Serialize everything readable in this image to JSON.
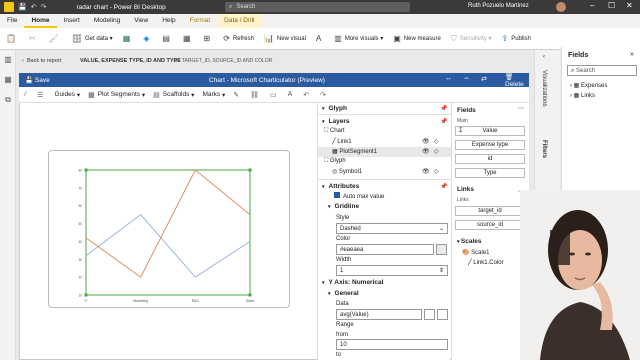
{
  "window": {
    "title": "radar chart - Power BI Desktop",
    "search_placeholder": "Search",
    "user": "Ruth Pozuelo Martinez"
  },
  "ribbon_tabs": [
    "File",
    "Home",
    "Insert",
    "Modeling",
    "View",
    "Help",
    "Format",
    "Data / Drill"
  ],
  "ribbon": {
    "get_data": "Get data",
    "refresh": "Refresh",
    "new_visual": "New visual",
    "more_visuals": "More visuals",
    "new_measure": "New measure",
    "sensitivity": "Sensitivity",
    "publish": "Publish"
  },
  "editor": {
    "back_label": "Back to report",
    "fields_caption": "VALUE, EXPENSE TYPE, ID AND TYPE",
    "by_caption": "BY TARGET_ID, SOURCE_ID AND COLOR",
    "save": "Save",
    "title": "Chart - Microsoft Charticulator (Preview)",
    "delete": "Delete",
    "toolbar": [
      "Guides",
      "Plot Segments",
      "Scaffolds",
      "Marks"
    ]
  },
  "glyph_panel": {
    "glyph": "Glyph",
    "layers": "Layers",
    "layer_items": [
      "Chart",
      "Link1",
      "PlotSegment1",
      "Glyph",
      "Symbol1"
    ],
    "attributes": "Attributes",
    "auto_max": "Auto max value",
    "gridline": "Gridline",
    "style_label": "Style",
    "style_value": "Dashed",
    "color_label": "Color",
    "color_value": "#eaeaea",
    "width_label": "Width",
    "width_value": "1",
    "y_axis": "Y Axis: Numerical",
    "general": "General",
    "data_label": "Data",
    "data_value": "avg(Value)",
    "range_label": "Range",
    "from_label": "from",
    "from_value": "10",
    "to_label": "to"
  },
  "fields_panel": {
    "fields": "Fields",
    "main": "Main",
    "main_items": [
      "Value",
      "Expense type",
      "id",
      "Type"
    ],
    "links": "Links",
    "links_sub": "Links",
    "links_items": [
      "target_id",
      "source_id",
      "color"
    ],
    "scales": "Scales",
    "scale_items": [
      "Scale1",
      "Link1.Color"
    ]
  },
  "pbi_fields": {
    "title": "Fields",
    "search_placeholder": "Search",
    "tables": [
      "Expenses",
      "Links"
    ]
  },
  "strip_labels": [
    "Visualizations",
    "Filters"
  ],
  "chart_data": {
    "type": "line",
    "categories": [
      "IT",
      "Marketing",
      "R&D",
      "Sales"
    ],
    "series": [
      {
        "values": [
          32,
          55,
          20,
          40
        ],
        "color": "#9ab5dd"
      },
      {
        "values": [
          42,
          20,
          80,
          55
        ],
        "color": "#e09060"
      }
    ],
    "y_ticks": [
      "80",
      "70",
      "60",
      "50",
      "40",
      "30",
      "20",
      "10"
    ],
    "axis_color": "#44aa44"
  }
}
